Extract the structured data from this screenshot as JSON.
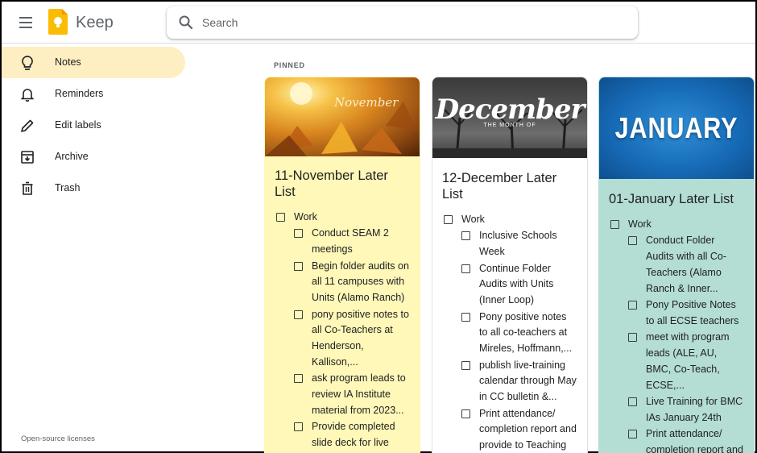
{
  "header": {
    "app_title": "Keep",
    "search_placeholder": "Search"
  },
  "sidebar": {
    "items": [
      {
        "label": "Notes",
        "icon": "lightbulb-icon",
        "active": true
      },
      {
        "label": "Reminders",
        "icon": "bell-icon",
        "active": false
      },
      {
        "label": "Edit labels",
        "icon": "pencil-icon",
        "active": false
      },
      {
        "label": "Archive",
        "icon": "archive-icon",
        "active": false
      },
      {
        "label": "Trash",
        "icon": "trash-icon",
        "active": false
      }
    ],
    "footer_link": "Open-source licenses"
  },
  "main": {
    "section_label": "PINNED",
    "notes": [
      {
        "title": "11-November Later List",
        "color": "#fff8b8",
        "image_text": "November",
        "items": [
          {
            "text": "Work",
            "indent": 0
          },
          {
            "text": "Conduct SEAM 2 meetings",
            "indent": 1
          },
          {
            "text": "Begin folder audits on all 11 campuses with Units (Alamo Ranch)",
            "indent": 1
          },
          {
            "text": "pony positive notes to all Co-Teachers at Henderson, Kallison,...",
            "indent": 1
          },
          {
            "text": "ask program leads to review IA Institute material from 2023...",
            "indent": 1
          },
          {
            "text": "Provide completed slide deck for live virtual training on",
            "indent": 1
          }
        ]
      },
      {
        "title": "12-December Later List",
        "color": "#ffffff",
        "image_text": "December",
        "image_subtext": "THE MONTH OF",
        "items": [
          {
            "text": "Work",
            "indent": 0
          },
          {
            "text": "Inclusive Schools Week",
            "indent": 1
          },
          {
            "text": "Continue Folder Audits with Units (Inner Loop)",
            "indent": 1
          },
          {
            "text": "Pony positive notes to all co-teachers at Mireles, Hoffmann,...",
            "indent": 1
          },
          {
            "text": "publish live-training calendar through May in CC bulletin &...",
            "indent": 1
          },
          {
            "text": "Print attendance/ completion report and provide to Teaching &...",
            "indent": 1
          }
        ]
      },
      {
        "title": "01-January Later List",
        "color": "#b4ddd3",
        "image_text": "JANUARY",
        "items": [
          {
            "text": "Work",
            "indent": 0
          },
          {
            "text": "Conduct Folder Audits with all Co-Teachers (Alamo Ranch & Inner...",
            "indent": 1
          },
          {
            "text": "Pony Positive Notes to all ECSE teachers",
            "indent": 1
          },
          {
            "text": "meet with program leads (ALE, AU, BMC, Co-Teach, ECSE,...",
            "indent": 1
          },
          {
            "text": "Live Training for BMC IAs January 24th",
            "indent": 1
          },
          {
            "text": "Print attendance/ completion report and provide to Teaching",
            "indent": 1
          }
        ]
      }
    ]
  }
}
